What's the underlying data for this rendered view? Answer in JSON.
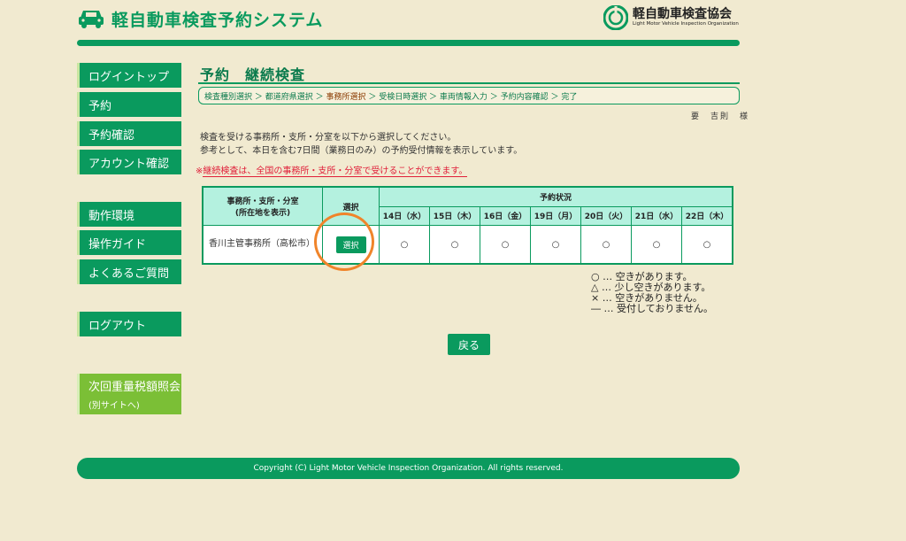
{
  "header": {
    "title": "軽自動車検査予約システム",
    "org_name": "軽自動車検査協会",
    "org_sub": "Light Motor Vehicle Inspection Organization"
  },
  "sidebar": {
    "items": [
      {
        "label": "ログイントップ"
      },
      {
        "label": "予約"
      },
      {
        "label": "予約確認"
      },
      {
        "label": "アカウント確認"
      },
      {
        "label": "動作環境"
      },
      {
        "label": "操作ガイド"
      },
      {
        "label": "よくあるご質問"
      },
      {
        "label": "ログアウト"
      }
    ],
    "external": {
      "label": "次回重量税額照会",
      "sub": "(別サイトへ)"
    }
  },
  "main": {
    "title": "予約　継続検査",
    "breadcrumb": {
      "step1": "検査種別選択 ＞ 都道府県選択 ＞ ",
      "current": "事務所選択",
      "rest": " ＞ 受検日時選択 ＞ 車両情報入力 ＞ 予約内容確認 ＞ 完了"
    },
    "user": "要　吉則　様",
    "instructions": [
      "検査を受ける事務所・支所・分室を以下から選択してください。",
      "参考として、本日を含む7日間（業務日のみ）の予約受付情報を表示しています。"
    ],
    "notice_prefix": "※",
    "notice": "継続検査は、全国の事務所・支所・分室で受けることができます。",
    "table": {
      "header_office": "事務所・支所・分室",
      "header_office_sub": "(所在地を表示)",
      "header_select": "選択",
      "header_status": "予約状況",
      "dates": [
        "14日（水）",
        "15日（木）",
        "16日（金）",
        "19日（月）",
        "20日（火）",
        "21日（水）",
        "22日（木）"
      ],
      "rows": [
        {
          "office": "香川主管事務所（高松市）",
          "select_label": "選択",
          "status": [
            "○",
            "○",
            "○",
            "○",
            "○",
            "○",
            "○"
          ]
        }
      ]
    },
    "legend": [
      "○ … 空きがあります。",
      "△ … 少し空きがあります。",
      "× … 空きがありません。",
      "― … 受付しておりません。"
    ],
    "back_label": "戻る"
  },
  "footer": {
    "copyright": "Copyright (C) Light Motor Vehicle Inspection Organization. All rights reserved."
  },
  "colors": {
    "background": "#f1ead0",
    "primary": "#0a9a5e",
    "table_header": "#b4f1df",
    "external_link": "#7bbf36",
    "notice": "#e0203a",
    "highlight": "#f0842a"
  }
}
